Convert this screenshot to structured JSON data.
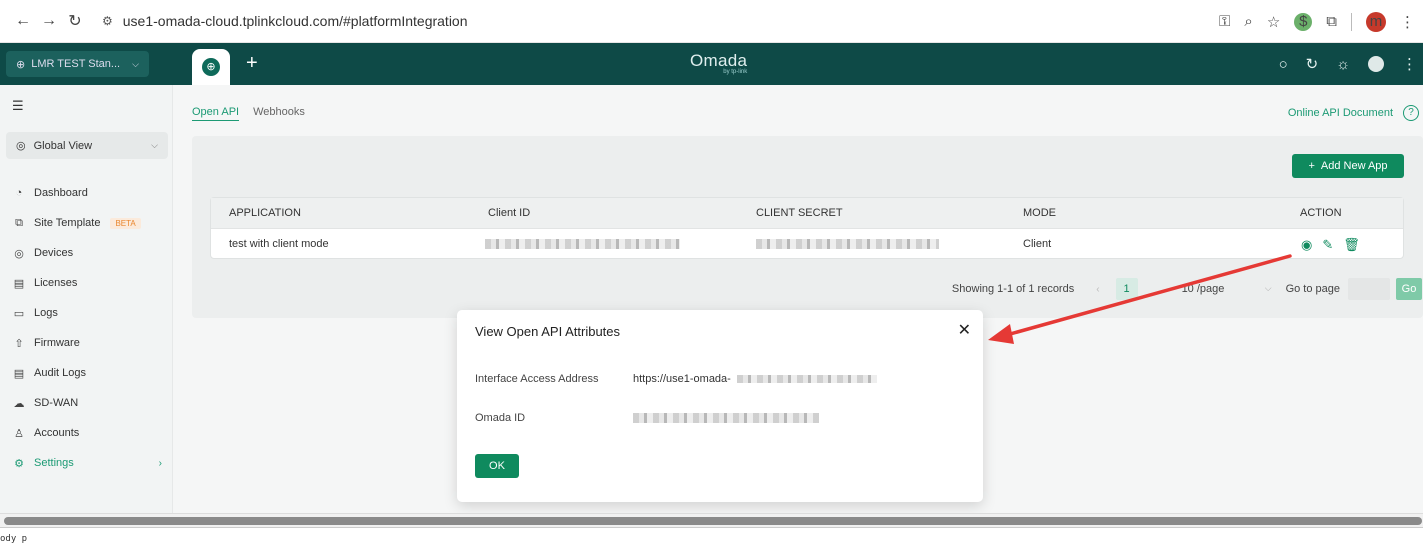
{
  "browser": {
    "url": "use1-omada-cloud.tplinkcloud.com/#platformIntegration",
    "avatar_letter": "m"
  },
  "appbar": {
    "site_name": "LMR TEST Stan...",
    "brand": "Omada",
    "brand_sub": "by tp-link"
  },
  "sidebar": {
    "global_view": "Global View",
    "items": [
      {
        "label": "Dashboard",
        "icon": "dashboard-icon"
      },
      {
        "label": "Site Template",
        "icon": "template-icon",
        "badge": "BETA"
      },
      {
        "label": "Devices",
        "icon": "devices-icon"
      },
      {
        "label": "Licenses",
        "icon": "license-icon"
      },
      {
        "label": "Logs",
        "icon": "logs-icon"
      },
      {
        "label": "Firmware",
        "icon": "firmware-icon"
      },
      {
        "label": "Audit Logs",
        "icon": "audit-icon"
      },
      {
        "label": "SD-WAN",
        "icon": "cloud-icon"
      },
      {
        "label": "Accounts",
        "icon": "user-icon"
      },
      {
        "label": "Settings",
        "icon": "gear-icon",
        "active": true
      }
    ]
  },
  "main": {
    "tabs": [
      {
        "label": "Open API",
        "active": true
      },
      {
        "label": "Webhooks",
        "active": false
      }
    ],
    "api_doc_link": "Online API Document",
    "add_button": "Add New App",
    "table": {
      "headers": [
        "APPLICATION",
        "Client ID",
        "CLIENT SECRET",
        "MODE",
        "ACTION"
      ],
      "rows": [
        {
          "application": "test with client mode",
          "mode": "Client"
        }
      ]
    },
    "pager": {
      "count": "Showing 1-1 of 1 records",
      "current_page": "1",
      "page_size": "10 /page",
      "goto_label": "Go to page",
      "go_button": "Go"
    }
  },
  "modal": {
    "title": "View Open API Attributes",
    "fields": [
      {
        "label": "Interface Access Address",
        "value": "https://use1-omada-"
      },
      {
        "label": "Omada ID",
        "value": ""
      }
    ],
    "ok_button": "OK"
  },
  "statusbar": {
    "text": "ody  p"
  },
  "colors": {
    "primary": "#0f8a5e",
    "topbar": "#0e4a47",
    "accent_text": "#1c9a74",
    "annotation_arrow": "#e53935"
  }
}
